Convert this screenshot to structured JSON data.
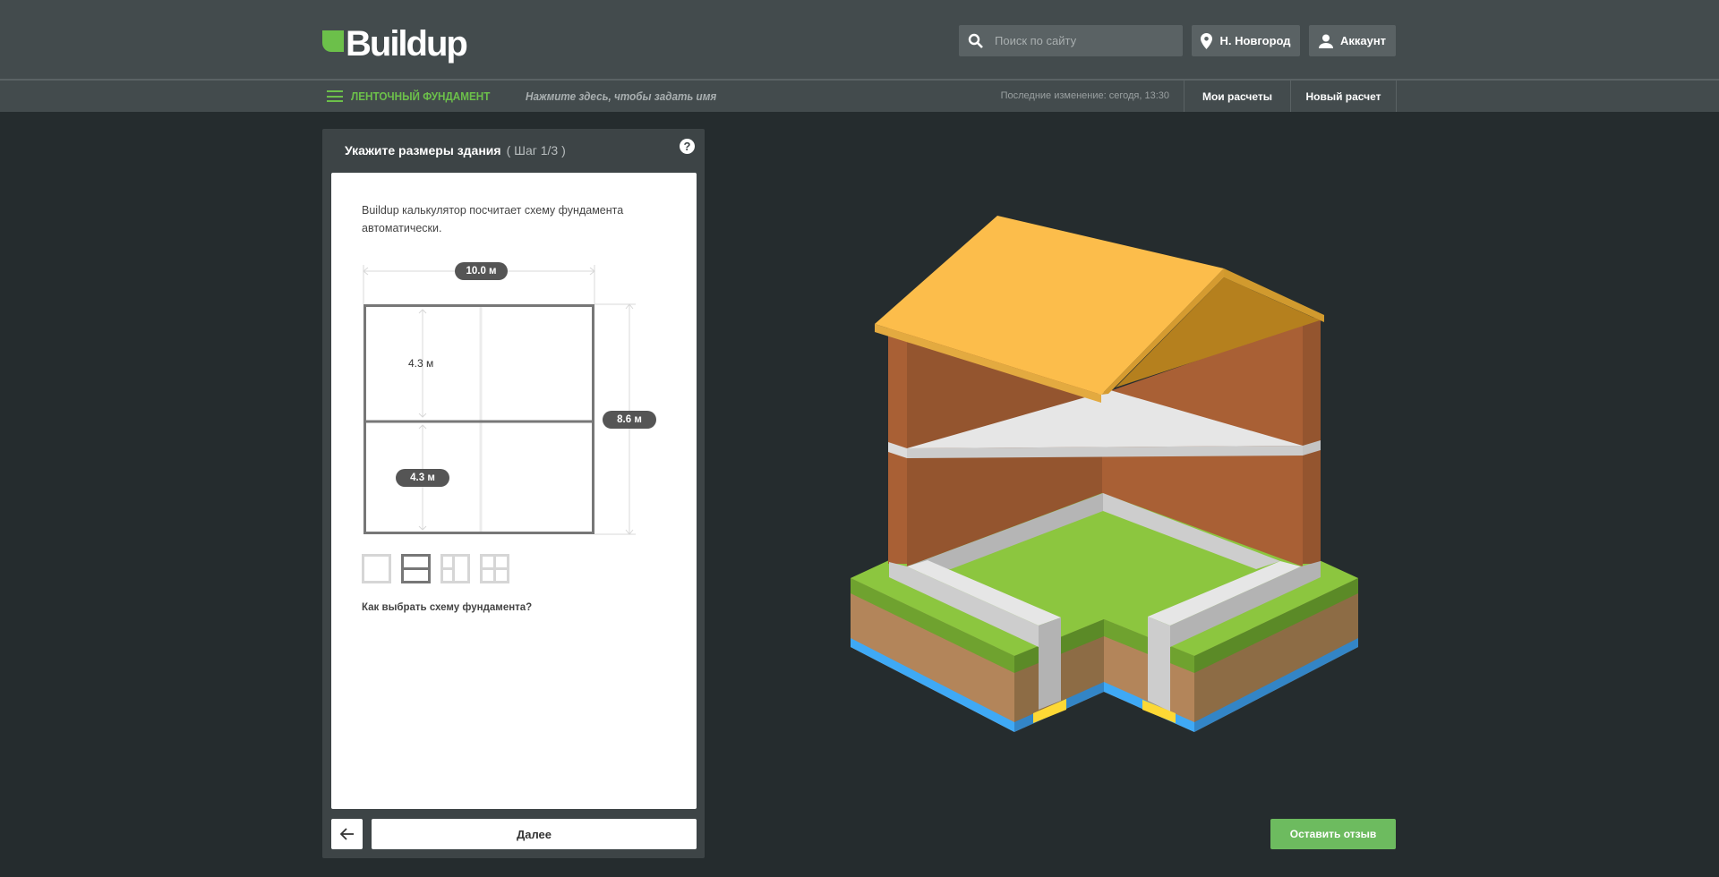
{
  "header": {
    "logo": "Buildup",
    "search_placeholder": "Поиск по сайту",
    "city": "Н. Новгород",
    "account": "Аккаунт"
  },
  "subbar": {
    "calc_type": "ЛЕНТОЧНЫЙ ФУНДАМЕНТ",
    "name_prompt": "Нажмите здесь, чтобы задать имя",
    "last_change": "Последние изменение: сегодя, 13:30",
    "my_calcs": "Мои расчеты",
    "new_calc": "Новый расчет"
  },
  "panel": {
    "title": "Укажите размеры здания",
    "step": "( Шаг 1/3 )",
    "help": "?",
    "description": "Buildup калькулятор посчитает схему фундамента автоматически.",
    "width": "10.0 м",
    "length": "8.6 м",
    "room_top": "4.3 м",
    "room_bottom": "4.3 м",
    "selected_scheme": 2,
    "help_link": "Как выбрать схему фундамента?",
    "next": "Далее"
  },
  "feedback": "Оставить отзыв",
  "colors": {
    "accent": "#6cc04a",
    "feedback": "#6dbb5f"
  }
}
